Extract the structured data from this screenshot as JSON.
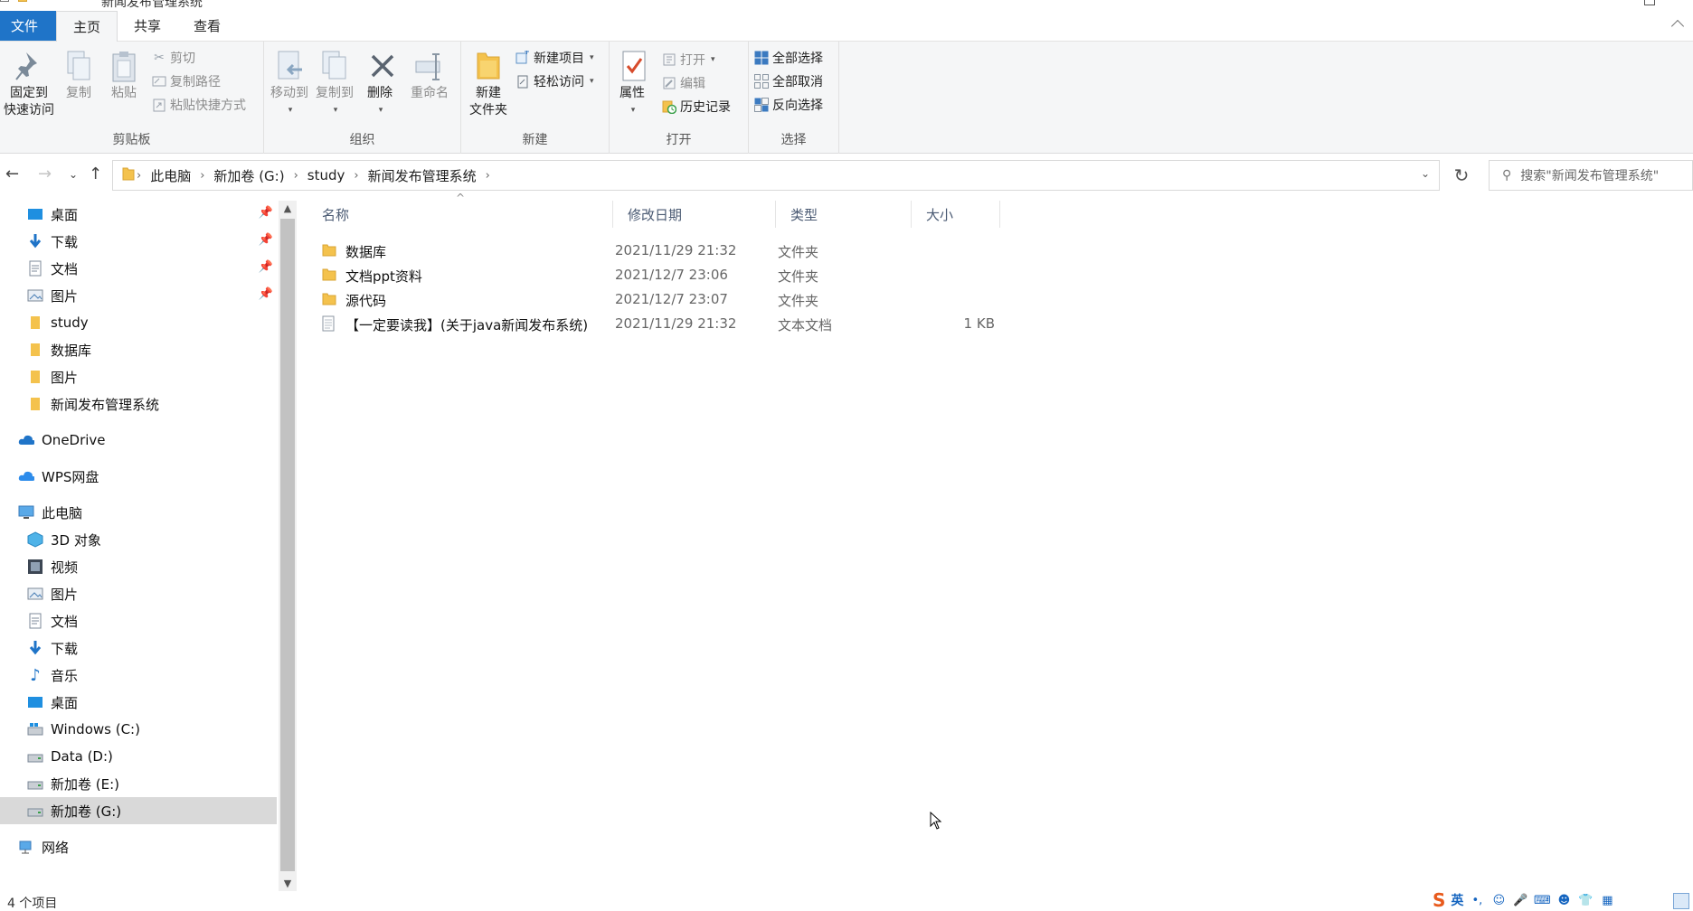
{
  "window": {
    "title": "新闻发布管理系统"
  },
  "ribbon_tabs": [
    "文件",
    "主页",
    "共享",
    "查看"
  ],
  "ribbon": {
    "clipboard": {
      "pin_line1": "固定到",
      "pin_line2": "快速访问",
      "copy": "复制",
      "paste": "粘贴",
      "cut": "剪切",
      "copy_path": "复制路径",
      "paste_shortcut": "粘贴快捷方式",
      "label": "剪贴板"
    },
    "organize": {
      "move_to": "移动到",
      "copy_to": "复制到",
      "delete": "删除",
      "rename": "重命名",
      "label": "组织"
    },
    "new": {
      "new_item": "新建项目",
      "easy_access": "轻松访问",
      "new_folder_line1": "新建",
      "new_folder_line2": "文件夹",
      "label": "新建"
    },
    "open": {
      "properties": "属性",
      "open": "打开",
      "edit": "编辑",
      "history": "历史记录",
      "label": "打开"
    },
    "select": {
      "select_all": "全部选择",
      "select_none": "全部取消",
      "invert": "反向选择",
      "label": "选择"
    }
  },
  "address": {
    "crumbs": [
      "此电脑",
      "新加卷 (G:)",
      "study",
      "新闻发布管理系统"
    ],
    "search_placeholder": "搜索\"新闻发布管理系统\""
  },
  "nav": {
    "quick_access": [
      {
        "label": "桌面",
        "icon": "desktop-icon",
        "pinned": true
      },
      {
        "label": "下载",
        "icon": "download-icon",
        "pinned": true
      },
      {
        "label": "文档",
        "icon": "document-icon",
        "pinned": true
      },
      {
        "label": "图片",
        "icon": "picture-icon",
        "pinned": true
      },
      {
        "label": "study",
        "icon": "folder-icon",
        "pinned": false
      },
      {
        "label": "数据库",
        "icon": "folder-icon",
        "pinned": false
      },
      {
        "label": "图片",
        "icon": "folder-icon",
        "pinned": false
      },
      {
        "label": "新闻发布管理系统",
        "icon": "folder-icon",
        "pinned": false
      }
    ],
    "onedrive": "OneDrive",
    "wps": "WPS网盘",
    "this_pc": "此电脑",
    "pc_items": [
      {
        "label": "3D 对象",
        "icon": "3d-objects-icon"
      },
      {
        "label": "视频",
        "icon": "video-icon"
      },
      {
        "label": "图片",
        "icon": "picture-icon"
      },
      {
        "label": "文档",
        "icon": "document-icon"
      },
      {
        "label": "下载",
        "icon": "download-icon"
      },
      {
        "label": "音乐",
        "icon": "music-icon"
      },
      {
        "label": "桌面",
        "icon": "desktop-icon"
      },
      {
        "label": "Windows (C:)",
        "icon": "windows-drive-icon"
      },
      {
        "label": "Data (D:)",
        "icon": "drive-icon"
      },
      {
        "label": "新加卷 (E:)",
        "icon": "drive-icon"
      },
      {
        "label": "新加卷 (G:)",
        "icon": "drive-icon",
        "selected": true
      }
    ],
    "network": "网络"
  },
  "columns": {
    "name": "名称",
    "date": "修改日期",
    "type": "类型",
    "size": "大小"
  },
  "files": [
    {
      "name": "数据库",
      "date": "2021/11/29 21:32",
      "type": "文件夹",
      "size": "",
      "icon": "folder-icon"
    },
    {
      "name": "文档ppt资料",
      "date": "2021/12/7 23:06",
      "type": "文件夹",
      "size": "",
      "icon": "folder-icon"
    },
    {
      "name": "源代码",
      "date": "2021/12/7 23:07",
      "type": "文件夹",
      "size": "",
      "icon": "folder-icon"
    },
    {
      "name": "【一定要读我】(关于java新闻发布系统)",
      "date": "2021/11/29 21:32",
      "type": "文本文档",
      "size": "1 KB",
      "icon": "text-file-icon"
    }
  ],
  "status": {
    "item_count": "4 个项目",
    "ime_lang": "英"
  },
  "colors": {
    "accent": "#1f74c8",
    "folder": "#f4c24d",
    "selected": "#d9d9d9"
  }
}
